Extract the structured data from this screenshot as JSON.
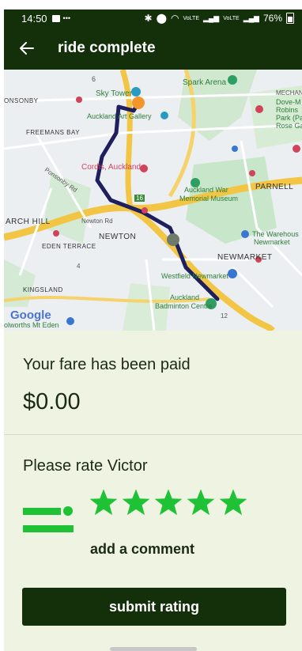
{
  "status_bar": {
    "time": "14:50",
    "network_label_1": "VoLTE",
    "network_label_2": "VoLTE",
    "battery": "76%"
  },
  "app_bar": {
    "title": "ride complete"
  },
  "map": {
    "attribution": "Google",
    "labels": {
      "sky_tower": "Sky Tower",
      "spark_arena": "Spark Arena",
      "onsonby": "ONSONBY",
      "freemans_bay": "FREEMANS BAY",
      "art_gallery": "Auckland Art Gallery",
      "mechan": "MECHAN",
      "dove": "Dove-M",
      "robins": "Robins",
      "park": "Park (Pa",
      "rose": "Rose Ga",
      "cordis": "Cordis, Auckland",
      "parnell": "PARNELL",
      "museum_1": "Auckland War",
      "museum_2": "Memorial Museum",
      "arch_hill": "ARCH HILL",
      "newton": "NEWTON",
      "eden_terrace": "EDEN TERRACE",
      "warehouse_1": "The Warehous",
      "warehouse_2": "Newmarket",
      "newmarket": "NEWMARKET",
      "westfield": "Westfield Newmarket",
      "kingsland": "KINGSLAND",
      "badminton_1": "Auckland",
      "badminton_2": "Badminton Centre",
      "woolworths": "olworths Mt Eden",
      "newton_rd": "Newton Rd",
      "ponsonby_rd": "Ponsonby Rd",
      "road_6": "6",
      "road_16": "16",
      "road_4": "4",
      "road_12": "12"
    }
  },
  "fare": {
    "label": "Your fare has been paid",
    "amount": "$0.00"
  },
  "rating": {
    "label": "Please rate Victor",
    "stars": 5,
    "max_stars": 5,
    "star_color": "#1fc234",
    "comment_link": "add a comment",
    "submit_label": "submit rating"
  },
  "colors": {
    "header": "#13300b",
    "panel": "#eef3e2",
    "accent": "#1fc234",
    "route": "#1f1f5e",
    "start_marker": "#f2962b",
    "end_marker": "#6d7b6a"
  }
}
